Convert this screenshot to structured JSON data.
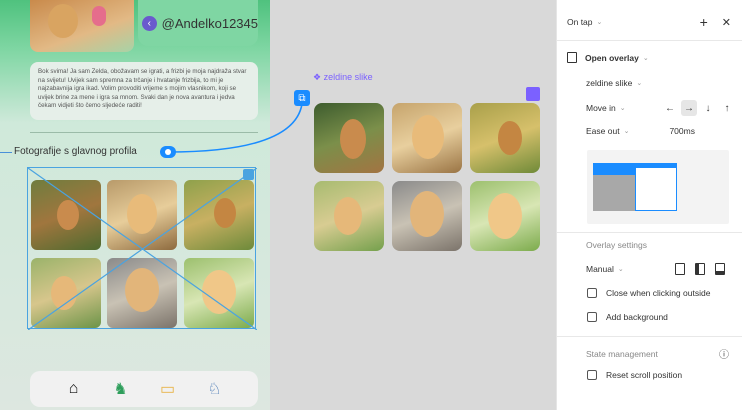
{
  "phone": {
    "username": "@Andelko12345",
    "bio": "Bok svima! Ja sam Zelda, obožavam se igrati, a frizbi je moja najdraža stvar na svijetu! Uvijek sam spremna za trčanje i hvatanje frizbija, to mi je najzabavnija igra ikad. Volim provoditi vrijeme s mojim vlasnikom, koji se uvijek brine za mene i igra sa mnom. Svaki dan je nova avantura i jedva čekam vidjeti što čemo sljedeće raditi!",
    "photos_title": "Fotografije s glavnog profila",
    "nav_icons": [
      "home-icon",
      "dog-walk-icon",
      "dog-bed-icon",
      "dog-run-icon"
    ]
  },
  "overlay": {
    "label": "❖ zeldine slike"
  },
  "panel": {
    "trigger": "On tap",
    "add_symbol": "+",
    "close_symbol": "✕",
    "action": "Open overlay",
    "destination": "zeldine slike",
    "animation": "Move in",
    "directions": [
      "←",
      "→",
      "↓",
      "↑"
    ],
    "active_direction": 1,
    "easing": "Ease out",
    "duration": "700ms",
    "overlay_settings_label": "Overlay settings",
    "position": "Manual",
    "close_when_clicking_outside": "Close when clicking outside",
    "add_background": "Add background",
    "state_management": "State management",
    "reset_scroll_position": "Reset scroll position",
    "info_symbol": "ⓘ"
  },
  "colors": {
    "accent": "#1a8cff",
    "overlay_purple": "#7b61ff",
    "phone_green": "#4fc27e"
  }
}
